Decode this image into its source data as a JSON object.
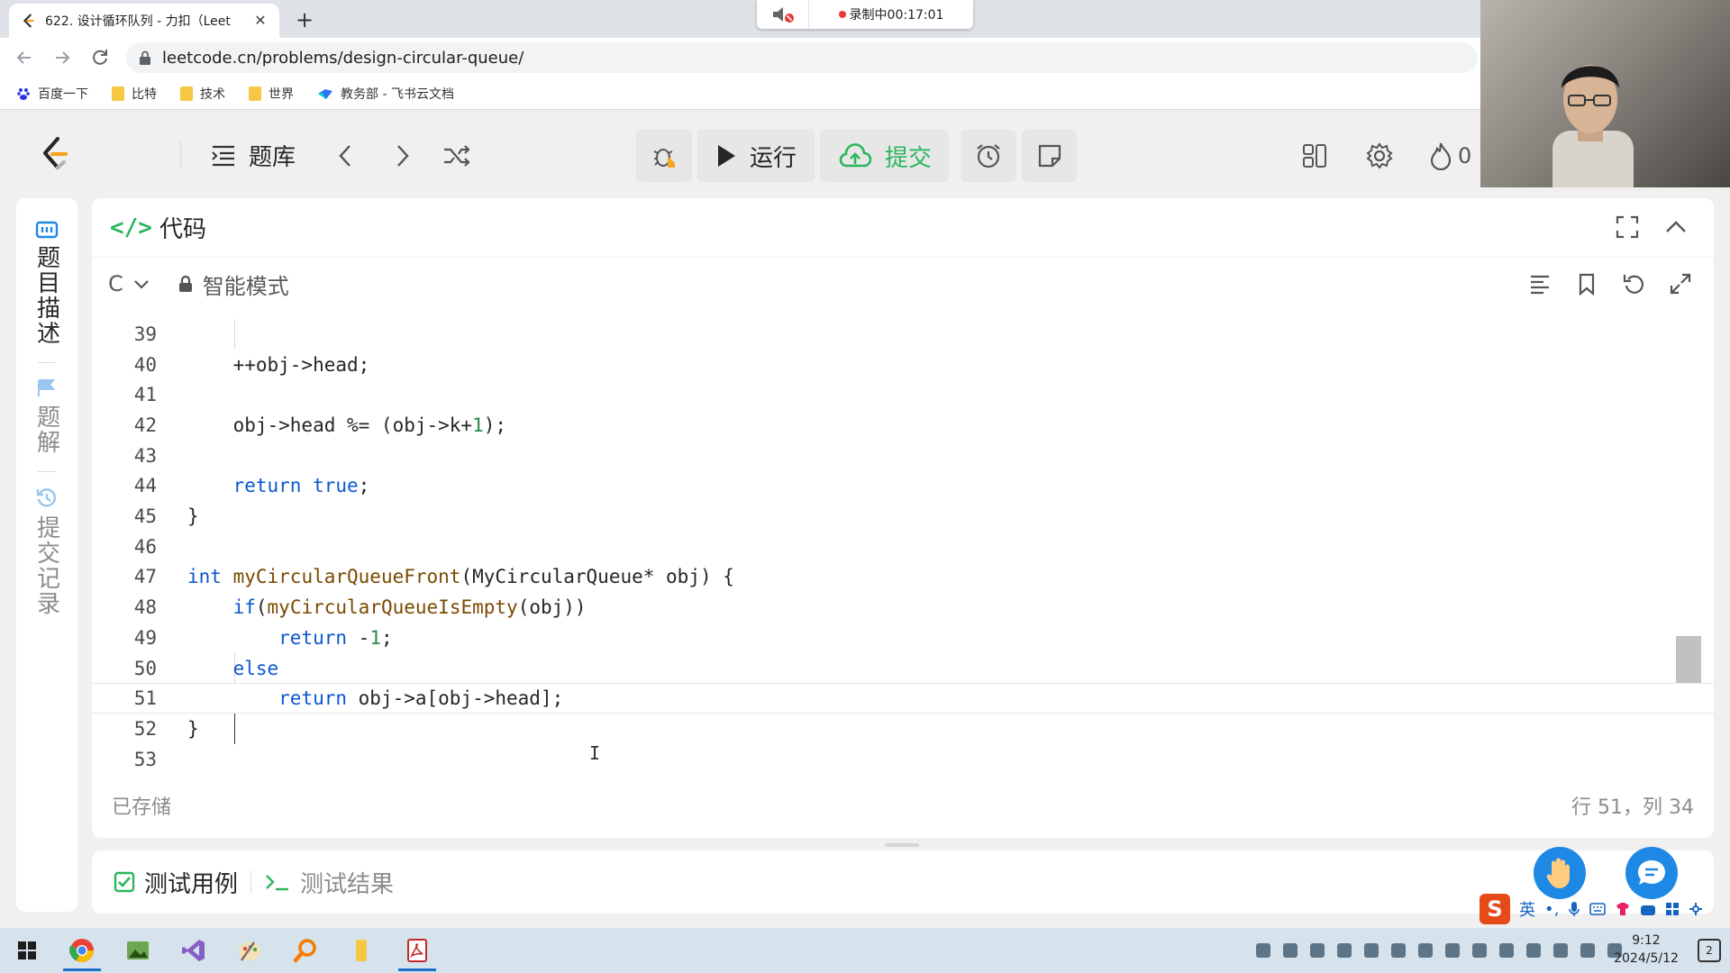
{
  "browser": {
    "tab_title": "622. 设计循环队列 - 力扣（Leet",
    "tab_close": "✕",
    "new_tab": "+",
    "url": "leetcode.cn/problems/design-circular-queue/",
    "bookmarks": [
      {
        "label": "百度一下",
        "icon": "baidu-icon"
      },
      {
        "label": "比特",
        "icon": "folder-icon"
      },
      {
        "label": "技术",
        "icon": "folder-icon"
      },
      {
        "label": "世界",
        "icon": "folder-icon"
      },
      {
        "label": "教务部 - 飞书云文档",
        "icon": "feishu-icon"
      }
    ]
  },
  "recorder": {
    "status": "录制中00:17:01"
  },
  "header": {
    "problem_set": "题库",
    "run": "运行",
    "submit": "提交",
    "streak": "0"
  },
  "sidenav": {
    "items": [
      {
        "label": "题目描述",
        "icon": "description-icon"
      },
      {
        "label": "题解",
        "icon": "flask-icon"
      },
      {
        "label": "提交记录",
        "icon": "history-icon"
      }
    ]
  },
  "code_panel": {
    "tag": "</>",
    "title": "代码",
    "language": "C",
    "mode": "智能模式",
    "saved_status": "已存储",
    "cursor_pos": "行 51，列 34",
    "current_line": 51,
    "lines": [
      {
        "n": "39",
        "code": ""
      },
      {
        "n": "40",
        "code": "    ++obj->head;"
      },
      {
        "n": "41",
        "code": ""
      },
      {
        "n": "42",
        "code": "    obj->head %= (obj->k+1);"
      },
      {
        "n": "43",
        "code": ""
      },
      {
        "n": "44",
        "code": "    return true;"
      },
      {
        "n": "45",
        "code": "}"
      },
      {
        "n": "46",
        "code": ""
      },
      {
        "n": "47",
        "code": "int myCircularQueueFront(MyCircularQueue* obj) {"
      },
      {
        "n": "48",
        "code": "    if(myCircularQueueIsEmpty(obj))"
      },
      {
        "n": "49",
        "code": "        return -1;"
      },
      {
        "n": "50",
        "code": "    else"
      },
      {
        "n": "51",
        "code": "        return obj->a[obj->head];"
      },
      {
        "n": "52",
        "code": "}"
      },
      {
        "n": "53",
        "code": ""
      }
    ]
  },
  "test_panel": {
    "tabs": [
      "测试用例",
      "测试结果"
    ]
  },
  "ime": {
    "lang": "英"
  },
  "taskbar": {
    "time": "9:12",
    "date": "2024/5/12",
    "notif_count": "2"
  },
  "colors": {
    "accent_green": "#2db55d",
    "keyword_blue": "#0b57d0",
    "function_brown": "#7a4a00"
  }
}
